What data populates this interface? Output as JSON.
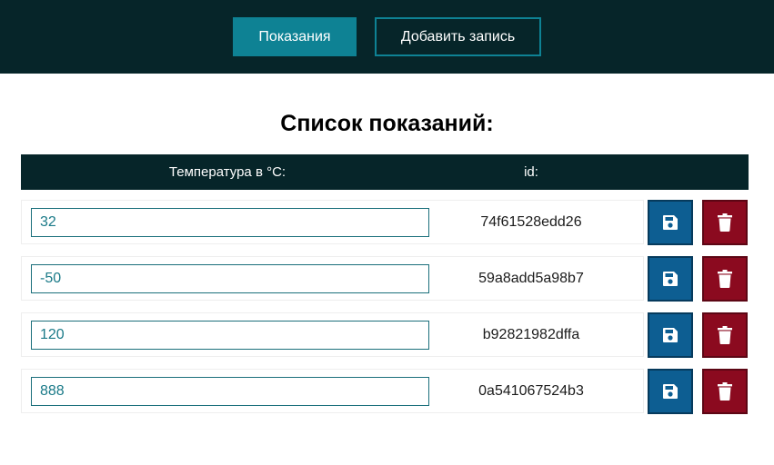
{
  "nav": {
    "readings_label": "Показания",
    "add_label": "Добавить запись"
  },
  "page": {
    "title": "Список показаний:"
  },
  "table": {
    "headers": {
      "temperature": "Температура в °C:",
      "id": "id:"
    },
    "rows": [
      {
        "temperature": "32",
        "id": "74f61528edd26"
      },
      {
        "temperature": "-50",
        "id": "59a8add5a98b7"
      },
      {
        "temperature": "120",
        "id": "b92821982dffa"
      },
      {
        "temperature": "888",
        "id": "0a541067524b3"
      }
    ]
  },
  "icons": {
    "save": "floppy-disk-icon",
    "delete": "trash-icon"
  },
  "colors": {
    "header_bg": "#062529",
    "accent": "#0e8294",
    "save_button": "#0d5e92",
    "delete_button": "#8b0a1f"
  }
}
